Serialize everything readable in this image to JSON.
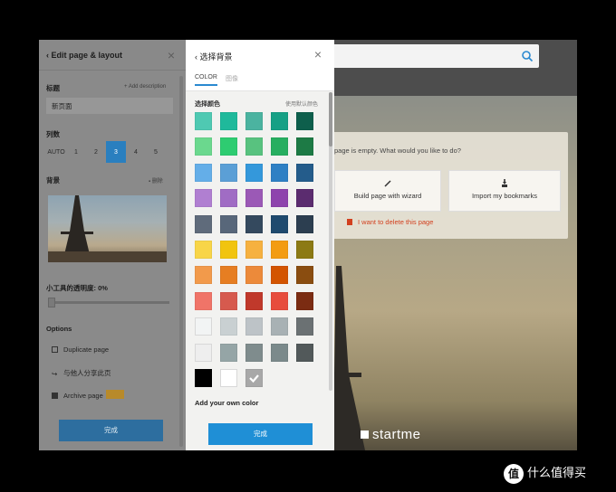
{
  "background_page": {
    "message": "page is empty. What would you like to do?",
    "wizard_button": "Build page with wizard",
    "bookmarks_button": "Import my bookmarks",
    "delete_link": "I want to delete this page",
    "logo": "startme"
  },
  "left_panel": {
    "title": "Edit page & layout",
    "title_label": "标题",
    "add_description": "+ Add description",
    "title_value": "新页面",
    "columns_label": "列数",
    "columns": [
      "AUTO",
      "1",
      "2",
      "3",
      "4",
      "5"
    ],
    "columns_selected": "3",
    "background_label": "背景",
    "delete_label": "删除",
    "opacity_label": "小工具的透明度: 0%",
    "opacity_value": 0,
    "options_label": "Options",
    "options": [
      "Duplicate page",
      "与他人分享此页",
      "Archive page"
    ],
    "done": "完成"
  },
  "color_panel": {
    "title": "选择背景",
    "tab_color": "COLOR",
    "tab_image": "图像",
    "pick_label": "选择颜色",
    "use_default": "使用默认颜色",
    "add_own": "Add your own color",
    "done": "完成",
    "selected": "#a8a8a8",
    "swatches": [
      [
        "#4fc9b2",
        "#1fb99b",
        "#4bb3a0",
        "#16a085",
        "#0e5f4c"
      ],
      [
        "#6bd88e",
        "#2ecc71",
        "#58c27f",
        "#27ae60",
        "#1d7a45"
      ],
      [
        "#64aee8",
        "#5b9fd6",
        "#3498db",
        "#2f80c4",
        "#245c8b"
      ],
      [
        "#b07fd1",
        "#a06cc4",
        "#9b59b6",
        "#8e44ad",
        "#5b2c6f"
      ],
      [
        "#5f6b7b",
        "#58677a",
        "#34495e",
        "#1f4a6e",
        "#2c3e50"
      ],
      [
        "#f8d548",
        "#f1c40f",
        "#f6b140",
        "#f39c12",
        "#8c7a14"
      ],
      [
        "#f29a4b",
        "#e67e22",
        "#ec8a3a",
        "#d35400",
        "#8a4d10"
      ],
      [
        "#f07468",
        "#d65a4e",
        "#c0392b",
        "#e74c3c",
        "#7b2c12"
      ],
      [
        "#f2f4f4",
        "#c9d0d2",
        "#bdc3c7",
        "#a8b1b4",
        "#6b7173"
      ],
      [
        "#eeeeee",
        "#95a5a6",
        "#7f8c8d",
        "#7b8a8b",
        "#52595a"
      ],
      [
        "#000000",
        "#ffffff",
        "#a8a8a8"
      ]
    ]
  },
  "watermark": "什么值得买"
}
